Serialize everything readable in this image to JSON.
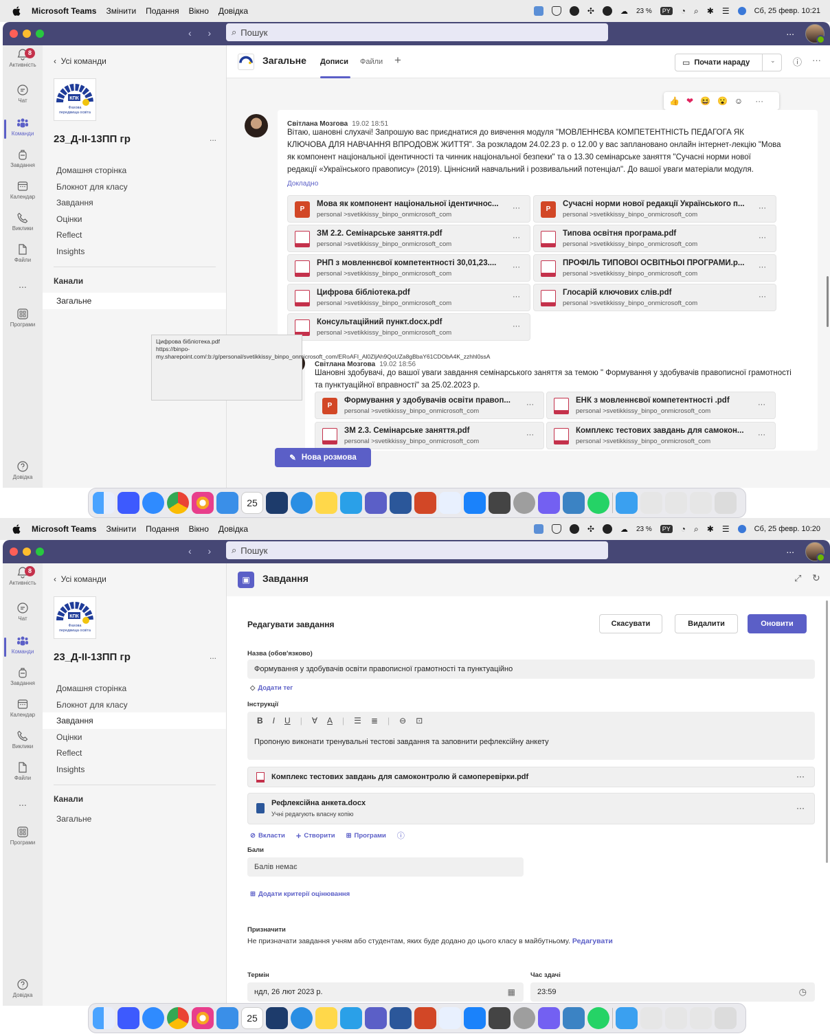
{
  "menubar": {
    "app_name": "Microsoft Teams",
    "items": [
      "Змінити",
      "Подання",
      "Вікно",
      "Довідка"
    ],
    "battery": "23 %",
    "keyboard": "PY",
    "datetime_top": "Сб, 25 февр.  10:21",
    "datetime_bottom": "Сб, 25 февр.  10:20"
  },
  "titlebar": {
    "search_placeholder": "Пошук",
    "more": "..."
  },
  "rail": {
    "activity": "Активність",
    "activity_badge": "8",
    "chat": "Чат",
    "teams": "Команди",
    "assignments": "Завдання",
    "calendar": "Календар",
    "calls": "Виклики",
    "files": "Файли",
    "more": "...",
    "apps": "Програми",
    "help": "Довідка"
  },
  "team": {
    "back": "Усі команди",
    "name": "23_Д-ІІ-13ПП гр",
    "dots": "...",
    "logo_text": "КПК",
    "logo_sub": "Фахова передвища освіта",
    "nav": [
      "Домашня сторінка",
      "Блокнот для класу",
      "Завдання",
      "Оцінки",
      "Reflect",
      "Insights"
    ],
    "channels_header": "Канали",
    "channel": "Загальне"
  },
  "channel": {
    "title": "Загальне",
    "tab_posts": "Дописи",
    "tab_files": "Файли",
    "meet": "Почати нараду",
    "reactions": [
      "👍",
      "❤",
      "😆",
      "😮",
      "☺"
    ]
  },
  "post1": {
    "author": "Світлана Мозгова",
    "time": "19.02 18:51",
    "text": "Вітаю, шановні слухачі! Запрошую вас приєднатися до вивчення модуля \"МОВЛЕННЄВА КОМПЕТЕНТНІСТЬ ПЕДАГОГА ЯК КЛЮЧОВА ДЛЯ НАВЧАННЯ ВПРОДОВЖ ЖИТТЯ\". За розкладом 24.02.23 р. о 12.00 у вас заплановано онлайн інтернет-лекцію \"Мова як компонент національної ідентичності та чинник національної безпеки\" та о 13.30 семінарське заняття \"Сучасні норми нової редакції «Українського правопису» (2019). Ціннісний навчальний і розвивальний потенціал\". До вашої уваги матеріали модуля.",
    "more": "Докладно",
    "files": [
      {
        "name": "Мова як компонент національної ідентичнос...",
        "path": "personal >svetikkissy_binpo_onmicrosoft_com",
        "type": "ppt"
      },
      {
        "name": "Сучасні норми нової редакції Українського п...",
        "path": "personal >svetikkissy_binpo_onmicrosoft_com",
        "type": "ppt"
      },
      {
        "name": "ЗМ 2.2. Семінарське заняття.pdf",
        "path": "personal >svetikkissy_binpo_onmicrosoft_com",
        "type": "pdf"
      },
      {
        "name": "Типова освітня програма.pdf",
        "path": "personal >svetikkissy_binpo_onmicrosoft_com",
        "type": "pdf"
      },
      {
        "name": "РНП з мовленнєвої компетентності 30,01,23....",
        "path": "personal >svetikkissy_binpo_onmicrosoft_com",
        "type": "pdf"
      },
      {
        "name": "ПРОФІЛЬ ТИПОВОЇ ОСВІТНЬОЇ ПРОГРАМИ.р...",
        "path": "personal >svetikkissy_binpo_onmicrosoft_com",
        "type": "pdf"
      },
      {
        "name": "Цифрова бібліотека.pdf",
        "path": "personal >svetikkissy_binpo_onmicrosoft_com",
        "type": "pdf"
      },
      {
        "name": "Глосарій ключових слів.pdf",
        "path": "personal >svetikkissy_binpo_onmicrosoft_com",
        "type": "pdf"
      },
      {
        "name": "Консультаційний пункт.docx.pdf",
        "path": "personal >svetikkissy_binpo_onmicrosoft_com",
        "type": "pdf"
      }
    ]
  },
  "tooltip": "Цифрова бібліотека.pdf\nhttps://binpo-my.sharepoint.com/:b:/g/personal/svetikkissy_binpo_onmicrosoft_com/ERoAFI_Al0ZljAh9QoUZa8gBbaY61CDObA4K_zzhhl0ssA",
  "post2": {
    "author": "Світлана Мозгова",
    "time": "19.02 18:56",
    "text": "Шановні здобувачі, до вашої уваги завдання семінарського заняття за темою \" Формування у здобувачів правописної грамотності та пунктуаційної вправності\" за 25.02.2023 р.",
    "files": [
      {
        "name": "Формування у здобувачів освіти правоп...",
        "path": "personal >svetikkissy_binpo_onmicrosoft_com",
        "type": "ppt"
      },
      {
        "name": "ЕНК з мовленнєвої компетентності .pdf",
        "path": "personal >svetikkissy_binpo_onmicrosoft_com",
        "type": "pdf"
      },
      {
        "name": "ЗМ 2.3. Семінарське заняття.pdf",
        "path": "personal >svetikkissy_binpo_onmicrosoft_com",
        "type": "pdf"
      },
      {
        "name": "Комплекс тестових завдань для самокон...",
        "path": "personal >svetikkissy_binpo_onmicrosoft_com",
        "type": "pdf"
      }
    ]
  },
  "new_conversation": "Нова розмова",
  "assignment": {
    "app_title": "Завдання",
    "heading": "Редагувати завдання",
    "cancel": "Скасувати",
    "delete": "Видалити",
    "update": "Оновити",
    "title_label": "Назва (обов'язково)",
    "title_value": "Формування у здобувачів освіти правописної грамотності та пунктуаційно",
    "add_tag": "Додати тег",
    "instructions_label": "Інструкції",
    "instructions_value": "Пропоную виконати тренувальні тестові завдання та заповнити рефлексійну анкету",
    "attachments": [
      {
        "name": "Комплекс тестових завдань для самоконтролю й самоперевірки.pdf",
        "sub": ""
      },
      {
        "name": "Рефлексійна анкета.docx",
        "sub": "Учні редагують власну копію"
      }
    ],
    "attach": "Вкласти",
    "create": "Створити",
    "programs": "Програми",
    "points_label": "Бали",
    "points_value": "Балів немає",
    "add_rubric": "Додати критерії оцінювання",
    "assign_label": "Призначити",
    "assign_text": "Не призначати завдання учням або студентам, яких буде додано до цього класу в майбутньому.",
    "assign_edit": "Редагувати",
    "due_label": "Термін",
    "due_value": "ндл, 26 лют 2023 р.",
    "time_label": "Час здачі",
    "time_value": "23:59"
  },
  "dock": {
    "calendar_month": "ФЕВР.",
    "calendar_day": "25"
  }
}
